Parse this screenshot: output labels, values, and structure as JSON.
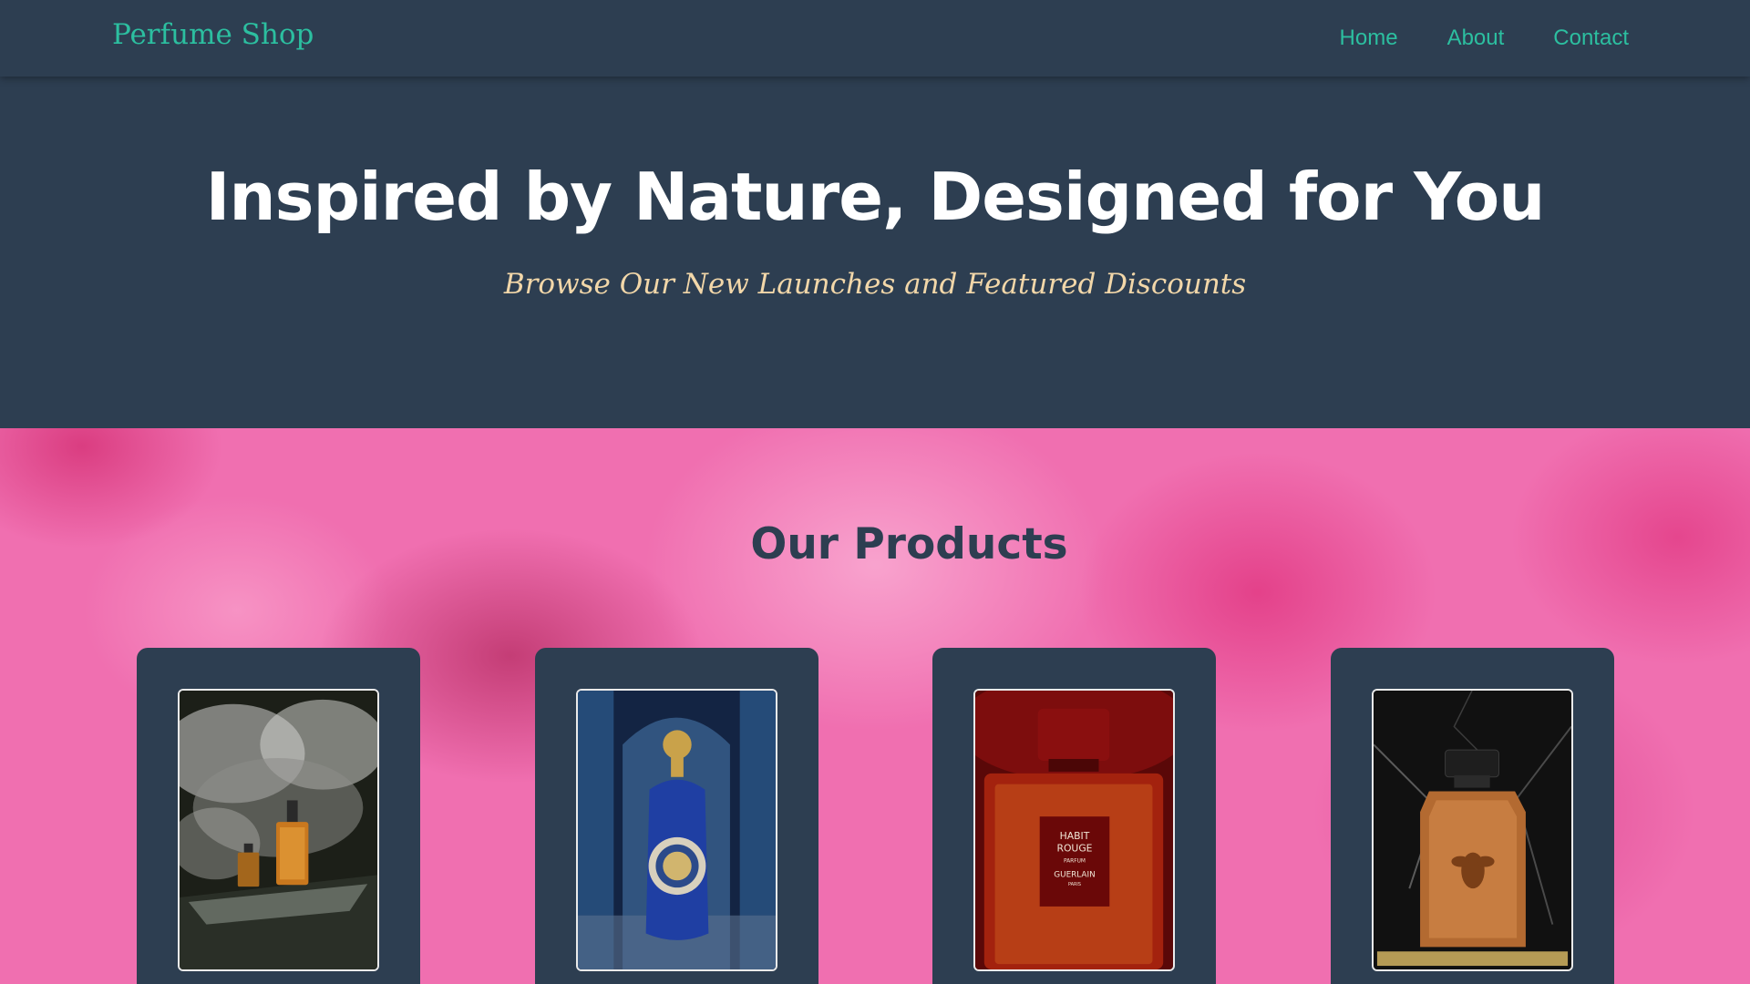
{
  "nav": {
    "brand": "Perfume Shop",
    "links": [
      "Home",
      "About",
      "Contact"
    ]
  },
  "hero": {
    "title": "Inspired by Nature, Designed for You",
    "subtitle": "Browse Our New Launches and Featured Discounts"
  },
  "products": {
    "heading": "Our Products",
    "cards": [
      {
        "image_icon": "smoke-perfume-image"
      },
      {
        "image_icon": "blue-bottle-image"
      },
      {
        "image_icon": "red-habit-rouge-image",
        "label_lines": [
          "HABIT",
          "ROUGE",
          "PARFUM",
          "GUERLAIN",
          "PARIS"
        ]
      },
      {
        "image_icon": "amber-bee-bottle-image"
      }
    ]
  },
  "colors": {
    "nav_bg": "#2d3e51",
    "accent": "#2cbfa0",
    "hero_title": "#ffffff",
    "hero_subtitle": "#f2d7a9",
    "products_bg": "#f06fb0",
    "card_bg": "#2d3e51"
  }
}
